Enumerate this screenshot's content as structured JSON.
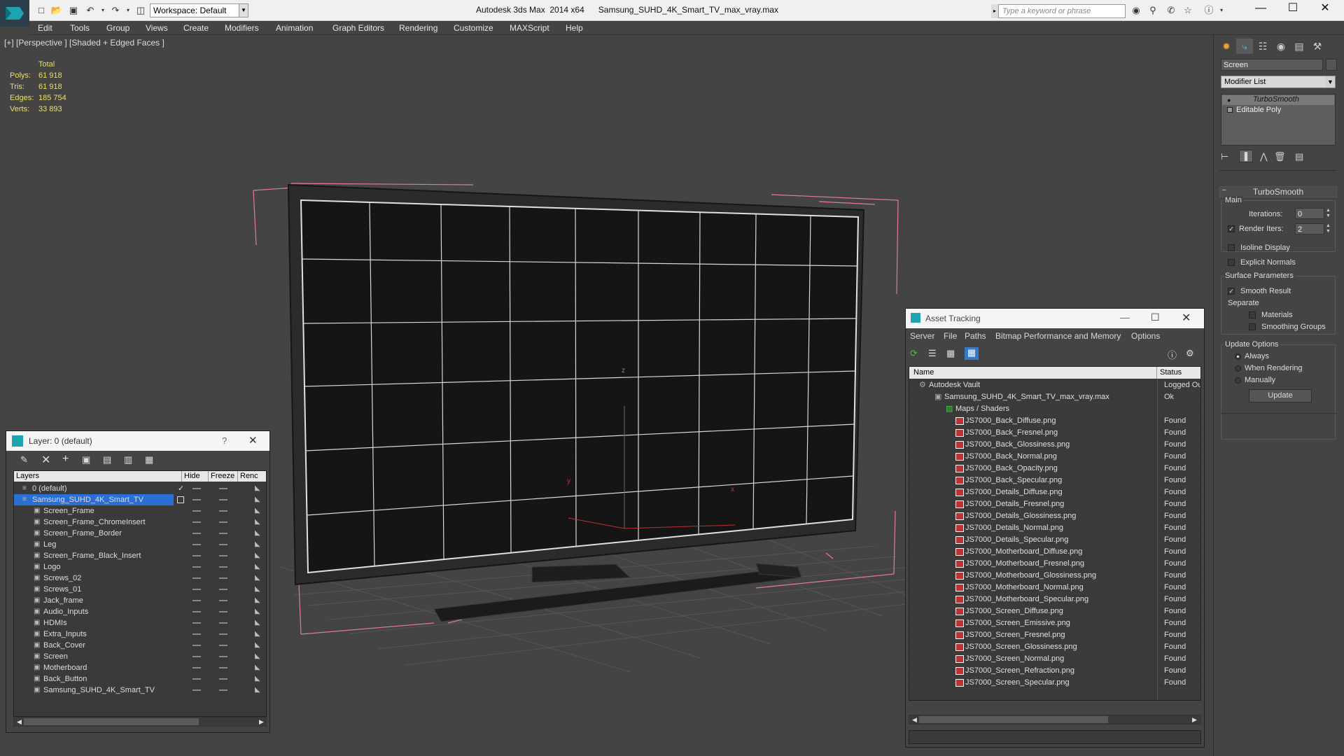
{
  "window": {
    "title": "Autodesk 3ds Max  2014 x64      Samsung_SUHD_4K_Smart_TV_max_vray.max",
    "workspace": "Workspace: Default",
    "search_placeholder": "Type a keyword or phrase"
  },
  "menu": [
    "Edit",
    "Tools",
    "Group",
    "Views",
    "Create",
    "Modifiers",
    "Animation",
    "Graph Editors",
    "Rendering",
    "Customize",
    "MAXScript",
    "Help"
  ],
  "viewport": {
    "label": "[+] [Perspective ] [Shaded + Edged Faces ]",
    "stats_header": "Total",
    "stats": [
      {
        "k": "Polys:",
        "v": "61 918"
      },
      {
        "k": "Tris:",
        "v": "61 918"
      },
      {
        "k": "Edges:",
        "v": "185 754"
      },
      {
        "k": "Verts:",
        "v": "33 893"
      }
    ],
    "axis_z": "z",
    "axis_x": "x",
    "axis_y": "y"
  },
  "command_panel": {
    "object_name": "Screen",
    "modifier_list": "Modifier List",
    "stack": [
      "TurboSmooth",
      "Editable Poly"
    ],
    "rollout_title": "TurboSmooth",
    "main_label": "Main",
    "iterations_label": "Iterations:",
    "iterations_value": "0",
    "render_iters_label": "Render Iters:",
    "render_iters_value": "2",
    "isoline_label": "Isoline Display",
    "explicit_normals_label": "Explicit Normals",
    "surface_params_label": "Surface Parameters",
    "smooth_result_label": "Smooth Result",
    "separate_label": "Separate",
    "materials_label": "Materials",
    "smoothing_groups_label": "Smoothing Groups",
    "update_options_label": "Update Options",
    "always_label": "Always",
    "when_rendering_label": "When Rendering",
    "manually_label": "Manually",
    "update_button": "Update"
  },
  "layer_dialog": {
    "title": "Layer: 0 (default)",
    "help": "?",
    "columns": [
      "Layers",
      "Hide",
      "Freeze",
      "Renc"
    ],
    "layers": [
      {
        "name": "0 (default)",
        "level": 1
      },
      {
        "name": "Samsung_SUHD_4K_Smart_TV",
        "level": 1,
        "selected": true
      },
      {
        "name": "Screen_Frame",
        "level": 2
      },
      {
        "name": "Screen_Frame_ChromeInsert",
        "level": 2
      },
      {
        "name": "Screen_Frame_Border",
        "level": 2
      },
      {
        "name": "Leg",
        "level": 2
      },
      {
        "name": "Screen_Frame_Black_Insert",
        "level": 2
      },
      {
        "name": "Logo",
        "level": 2
      },
      {
        "name": "Screws_02",
        "level": 2
      },
      {
        "name": "Screws_01",
        "level": 2
      },
      {
        "name": "Jack_frame",
        "level": 2
      },
      {
        "name": "Audio_Inputs",
        "level": 2
      },
      {
        "name": "HDMIs",
        "level": 2
      },
      {
        "name": "Extra_Inputs",
        "level": 2
      },
      {
        "name": "Back_Cover",
        "level": 2
      },
      {
        "name": "Screen",
        "level": 2
      },
      {
        "name": "Motherboard",
        "level": 2
      },
      {
        "name": "Back_Button",
        "level": 2
      },
      {
        "name": "Samsung_SUHD_4K_Smart_TV",
        "level": 2
      }
    ]
  },
  "asset_dialog": {
    "title": "Asset Tracking",
    "menu": [
      "Server",
      "File",
      "Paths",
      "Bitmap Performance and Memory",
      "Options"
    ],
    "columns": [
      "Name",
      "Status"
    ],
    "rows": [
      {
        "name": "Autodesk Vault",
        "status": "Logged Ou",
        "indent": 14,
        "icon": "vault"
      },
      {
        "name": "Samsung_SUHD_4K_Smart_TV_max_vray.max",
        "status": "Ok",
        "indent": 36,
        "icon": "max"
      },
      {
        "name": "Maps / Shaders",
        "status": "",
        "indent": 52,
        "icon": "folder"
      },
      {
        "name": "JS7000_Back_Diffuse.png",
        "status": "Found",
        "indent": 66,
        "icon": "png"
      },
      {
        "name": "JS7000_Back_Fresnel.png",
        "status": "Found",
        "indent": 66,
        "icon": "png"
      },
      {
        "name": "JS7000_Back_Glossiness.png",
        "status": "Found",
        "indent": 66,
        "icon": "png"
      },
      {
        "name": "JS7000_Back_Normal.png",
        "status": "Found",
        "indent": 66,
        "icon": "png"
      },
      {
        "name": "JS7000_Back_Opacity.png",
        "status": "Found",
        "indent": 66,
        "icon": "png"
      },
      {
        "name": "JS7000_Back_Specular.png",
        "status": "Found",
        "indent": 66,
        "icon": "png"
      },
      {
        "name": "JS7000_Details_Diffuse.png",
        "status": "Found",
        "indent": 66,
        "icon": "png"
      },
      {
        "name": "JS7000_Details_Fresnel.png",
        "status": "Found",
        "indent": 66,
        "icon": "png"
      },
      {
        "name": "JS7000_Details_Glossiness.png",
        "status": "Found",
        "indent": 66,
        "icon": "png"
      },
      {
        "name": "JS7000_Details_Normal.png",
        "status": "Found",
        "indent": 66,
        "icon": "png"
      },
      {
        "name": "JS7000_Details_Specular.png",
        "status": "Found",
        "indent": 66,
        "icon": "png"
      },
      {
        "name": "JS7000_Motherboard_Diffuse.png",
        "status": "Found",
        "indent": 66,
        "icon": "png"
      },
      {
        "name": "JS7000_Motherboard_Fresnel.png",
        "status": "Found",
        "indent": 66,
        "icon": "png"
      },
      {
        "name": "JS7000_Motherboard_Glossiness.png",
        "status": "Found",
        "indent": 66,
        "icon": "png"
      },
      {
        "name": "JS7000_Motherboard_Normal.png",
        "status": "Found",
        "indent": 66,
        "icon": "png"
      },
      {
        "name": "JS7000_Motherboard_Specular.png",
        "status": "Found",
        "indent": 66,
        "icon": "png"
      },
      {
        "name": "JS7000_Screen_Diffuse.png",
        "status": "Found",
        "indent": 66,
        "icon": "png"
      },
      {
        "name": "JS7000_Screen_Emissive.png",
        "status": "Found",
        "indent": 66,
        "icon": "png"
      },
      {
        "name": "JS7000_Screen_Fresnel.png",
        "status": "Found",
        "indent": 66,
        "icon": "png"
      },
      {
        "name": "JS7000_Screen_Glossiness.png",
        "status": "Found",
        "indent": 66,
        "icon": "png"
      },
      {
        "name": "JS7000_Screen_Normal.png",
        "status": "Found",
        "indent": 66,
        "icon": "png"
      },
      {
        "name": "JS7000_Screen_Refraction.png",
        "status": "Found",
        "indent": 66,
        "icon": "png"
      },
      {
        "name": "JS7000_Screen_Specular.png",
        "status": "Found",
        "indent": 66,
        "icon": "png"
      }
    ]
  },
  "colors": {
    "selection": "#2a6fd6",
    "viewport_bg": "#444444",
    "stats_text": "#e8e06a",
    "bbox": "#e47a9a"
  }
}
